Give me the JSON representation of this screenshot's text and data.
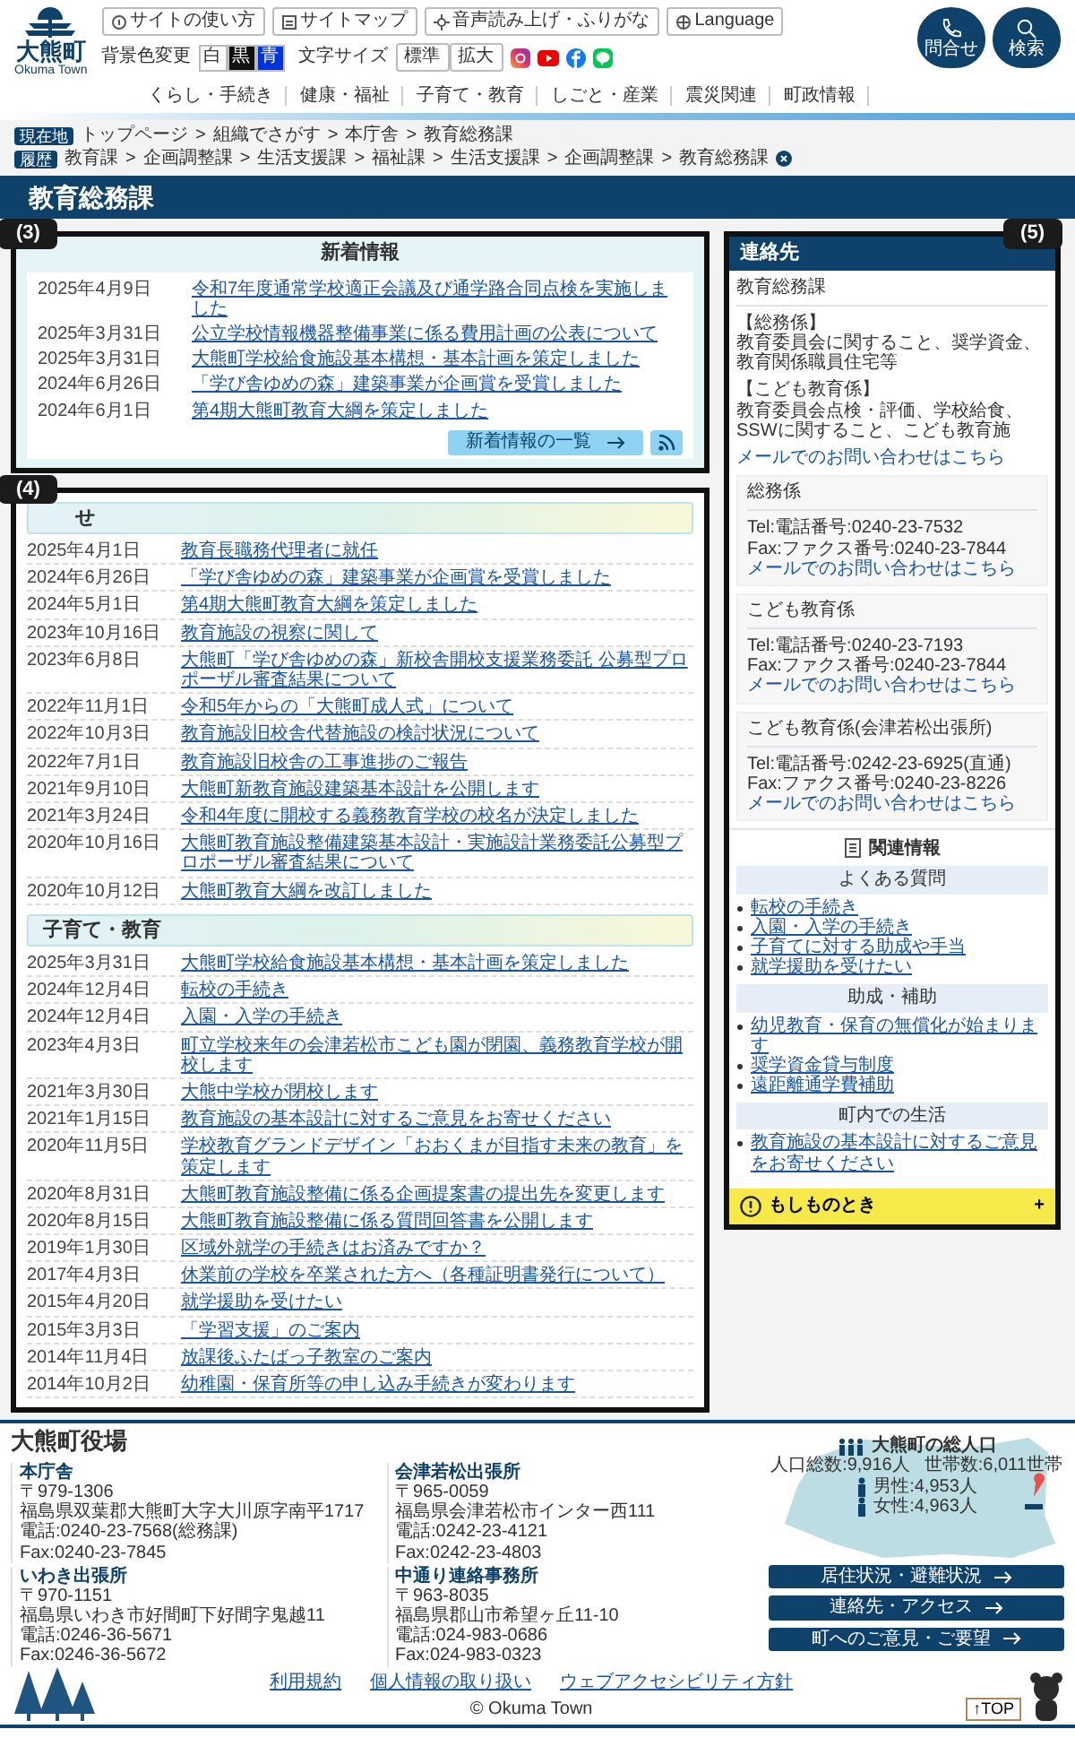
{
  "header": {
    "logo": {
      "name": "大熊町",
      "sub": "Okuma Town"
    },
    "utility_links": [
      "サイトの使い方",
      "サイトマップ",
      "音声読み上げ・ふりがな",
      "Language"
    ],
    "bg_color": {
      "label": "背景色変更",
      "options": [
        {
          "label": "白",
          "kind": "white"
        },
        {
          "label": "黒",
          "kind": "black"
        },
        {
          "label": "青",
          "kind": "blue"
        }
      ]
    },
    "font_size": {
      "label": "文字サイズ",
      "options": [
        "標準",
        "拡大"
      ]
    },
    "round_buttons": [
      {
        "label": "問合せ",
        "kind": "phone"
      },
      {
        "label": "検索",
        "kind": "search"
      }
    ],
    "nav": [
      "くらし・手続き",
      "健康・福祉",
      "子育て・教育",
      "しごと・産業",
      "震災関連",
      "町政情報"
    ]
  },
  "breadcrumb": {
    "label": "現在地",
    "separator": ">",
    "items": [
      "トップページ",
      "組織でさがす",
      "本庁舎",
      "教育総務課"
    ]
  },
  "history": {
    "label": "履歴",
    "separator": ">",
    "items": [
      "教育課",
      "企画調整課",
      "生活支援課",
      "福祉課",
      "生活支援課",
      "企画調整課",
      "教育総務課"
    ]
  },
  "page_title": "教育総務課",
  "annotations": [
    {
      "label": "(3)",
      "kind": "left"
    },
    {
      "label": "(4)",
      "kind": "left"
    },
    {
      "label": "(5)",
      "kind": "right"
    }
  ],
  "news": {
    "title": "新着情報",
    "items": [
      {
        "date": "2025年4月9日",
        "title": "令和7年度通常学校適正会議及び通学路合同点検を実施しました"
      },
      {
        "date": "2025年3月31日",
        "title": "公立学校情報機器整備事業に係る費用計画の公表について"
      },
      {
        "date": "2025年3月31日",
        "title": "大熊町学校給食施設基本構想・基本計画を策定しました"
      },
      {
        "date": "2024年6月26日",
        "title": "「学び舎ゆめの森」建築事業が企画賞を受賞しました"
      },
      {
        "date": "2024年6月1日",
        "title": "第4期大熊町教育大綱を策定しました"
      }
    ],
    "more_button": "新着情報の一覧"
  },
  "sections": [
    {
      "title": "せ",
      "items": [
        {
          "date": "2025年4月1日",
          "title": "教育長職務代理者に就任"
        },
        {
          "date": "2024年6月26日",
          "title": "「学び舎ゆめの森」建築事業が企画賞を受賞しました"
        },
        {
          "date": "2024年5月1日",
          "title": "第4期大熊町教育大綱を策定しました"
        },
        {
          "date": "2023年10月16日",
          "title": "教育施設の視察に関して"
        },
        {
          "date": "2023年6月8日",
          "title": "大熊町「学び舎ゆめの森」新校舎開校支援業務委託 公募型プロポーザル審査結果について"
        },
        {
          "date": "2022年11月1日",
          "title": "令和5年からの「大熊町成人式」について"
        },
        {
          "date": "2022年10月3日",
          "title": "教育施設旧校舎代替施設の検討状況について"
        },
        {
          "date": "2022年7月1日",
          "title": "教育施設旧校舎の工事進捗のご報告"
        },
        {
          "date": "2021年9月10日",
          "title": "大熊町新教育施設建築基本設計を公開します"
        },
        {
          "date": "2021年3月24日",
          "title": "令和4年度に開校する義務教育学校の校名が決定しました"
        },
        {
          "date": "2020年10月16日",
          "title": "大熊町教育施設整備建築基本設計・実施設計業務委託公募型プロポーザル審査結果について"
        },
        {
          "date": "2020年10月12日",
          "title": "大熊町教育大綱を改訂しました"
        }
      ]
    },
    {
      "title": "子育て・教育",
      "items": [
        {
          "date": "2025年3月31日",
          "title": "大熊町学校給食施設基本構想・基本計画を策定しました"
        },
        {
          "date": "2024年12月4日",
          "title": "転校の手続き"
        },
        {
          "date": "2024年12月4日",
          "title": "入園・入学の手続き"
        },
        {
          "date": "2023年4月3日",
          "title": "町立学校来年の会津若松市こども園が閉園、義務教育学校が開校します"
        },
        {
          "date": "2021年3月30日",
          "title": "大熊中学校が閉校します"
        },
        {
          "date": "2021年1月15日",
          "title": "教育施設の基本設計に対するご意見をお寄せください"
        },
        {
          "date": "2020年11月5日",
          "title": "学校教育グランドデザイン「おおくまが目指す未来の教育」を策定します"
        },
        {
          "date": "2020年8月31日",
          "title": "大熊町教育施設整備に係る企画提案書の提出先を変更します"
        },
        {
          "date": "2020年8月15日",
          "title": "大熊町教育施設整備に係る質問回答書を公開します"
        },
        {
          "date": "2019年1月30日",
          "title": "区域外就学の手続きはお済みですか？"
        },
        {
          "date": "2017年4月3日",
          "title": "休業前の学校を卒業された方へ（各種証明書発行について）"
        },
        {
          "date": "2015年4月20日",
          "title": "就学援助を受けたい"
        },
        {
          "date": "2015年3月3日",
          "title": "「学習支援」のご案内"
        },
        {
          "date": "2014年11月4日",
          "title": "放課後ふたばっ子教室のご案内"
        },
        {
          "date": "2014年10月2日",
          "title": "幼稚園・保育所等の申し込み手続きが変わります"
        }
      ]
    }
  ],
  "contact": {
    "title": "連絡先",
    "department": "教育総務課",
    "duties": [
      {
        "heading": "【総務係】",
        "text": "教育委員会に関すること、奨学資金、教育関係職員住宅等"
      },
      {
        "heading": "【こども教育係】",
        "text": "教育委員会点検・評価、学校給食、SSWに関すること、こども教育施"
      }
    ],
    "mail": "メールでのお問い合わせはこちら",
    "groups": [
      {
        "title": "総務係",
        "tel": "Tel:電話番号:0240-23-7532",
        "fax": "Fax:ファクス番号:0240-23-7844",
        "mail": "メールでのお問い合わせはこちら"
      },
      {
        "title": "こども教育係",
        "tel": "Tel:電話番号:0240-23-7193",
        "fax": "Fax:ファクス番号:0240-23-7844",
        "mail": "メールでのお問い合わせはこちら"
      },
      {
        "title": "こども教育係(会津若松出張所)",
        "tel": "Tel:電話番号:0242-23-6925(直通)",
        "fax": "Fax:ファクス番号:0240-23-8226",
        "mail": "メールでのお問い合わせはこちら"
      }
    ]
  },
  "related": {
    "title": "関連情報",
    "categories": [
      {
        "title": "よくある質問",
        "links": [
          "転校の手続き",
          "入園・入学の手続き",
          "子育てに対する助成や手当",
          "就学援助を受けたい"
        ]
      },
      {
        "title": "助成・補助",
        "links": [
          "幼児教育・保育の無償化が始まります",
          "奨学資金貸与制度",
          "遠距離通学費補助"
        ]
      },
      {
        "title": "町内での生活",
        "links": [
          "教育施設の基本設計に対するご意見をお寄せください"
        ]
      }
    ]
  },
  "emergency": {
    "label": "もしものとき",
    "toggle": "+"
  },
  "footer": {
    "title": "大熊町役場",
    "offices": [
      {
        "name": "本庁舎",
        "lines": [
          "〒979-1306",
          "福島県双葉郡大熊町大字大川原字南平1717",
          "電話:0240-23-7568(総務課)",
          "Fax:0240-23-7845"
        ]
      },
      {
        "name": "会津若松出張所",
        "lines": [
          "〒965-0059",
          "福島県会津若松市インター西111",
          "電話:0242-23-4121",
          "Fax:0242-23-4803"
        ]
      },
      {
        "name": "いわき出張所",
        "lines": [
          "〒970-1151",
          "福島県いわき市好間町下好間字鬼越11",
          "電話:0246-36-5671",
          "Fax:0246-36-5672"
        ]
      },
      {
        "name": "中通り連絡事務所",
        "lines": [
          "〒963-8035",
          "福島県郡山市希望ヶ丘11-10",
          "電話:024-983-0686",
          "Fax:024-983-0323"
        ]
      }
    ],
    "population": {
      "title": "大熊町の総人口",
      "total": "人口総数:9,916人",
      "households": "世帯数:6,011世帯",
      "male": "男性:4,953人",
      "female": "女性:4,963人",
      "button": "居住状況・避難状況"
    },
    "buttons": [
      "連絡先・アクセス",
      "町へのご意見・ご要望"
    ],
    "links": [
      "利用規約",
      "個人情報の取り扱い",
      "ウェブアクセシビリティ方針"
    ],
    "copyright": "© Okuma Town",
    "top": "↑TOP"
  }
}
